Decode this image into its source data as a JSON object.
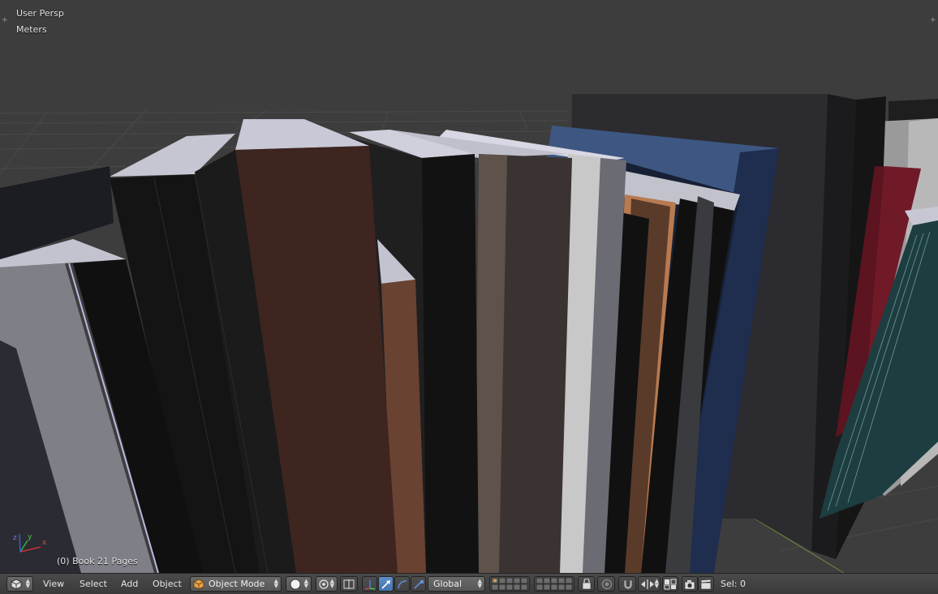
{
  "viewport": {
    "view_label": "User Persp",
    "units_label": "Meters",
    "object_info": "(0) Book 21 Pages",
    "axis_labels": {
      "x": "x",
      "y": "y",
      "z": "z"
    }
  },
  "header": {
    "menus": [
      "View",
      "Select",
      "Add",
      "Object"
    ],
    "mode": "Object Mode",
    "orientation": "Global",
    "selection": "Sel: 0"
  },
  "colors": {
    "viewport_bg": "#3d3d3d",
    "header_bg": "#444444",
    "active_blue": "#5d8ec7",
    "mode_icon": "#e8a047"
  },
  "icons": [
    "editor-type-icon",
    "shading-sphere-icon",
    "pivot-point-icon",
    "manipulator-icon",
    "translate-icon",
    "rotate-icon",
    "scale-icon",
    "layers-grid-icon",
    "lock-icon",
    "proportional-edit-icon",
    "snap-magnet-icon",
    "mirror-icon",
    "snap-element-icon",
    "render-camera-icon",
    "clapper-icon"
  ]
}
